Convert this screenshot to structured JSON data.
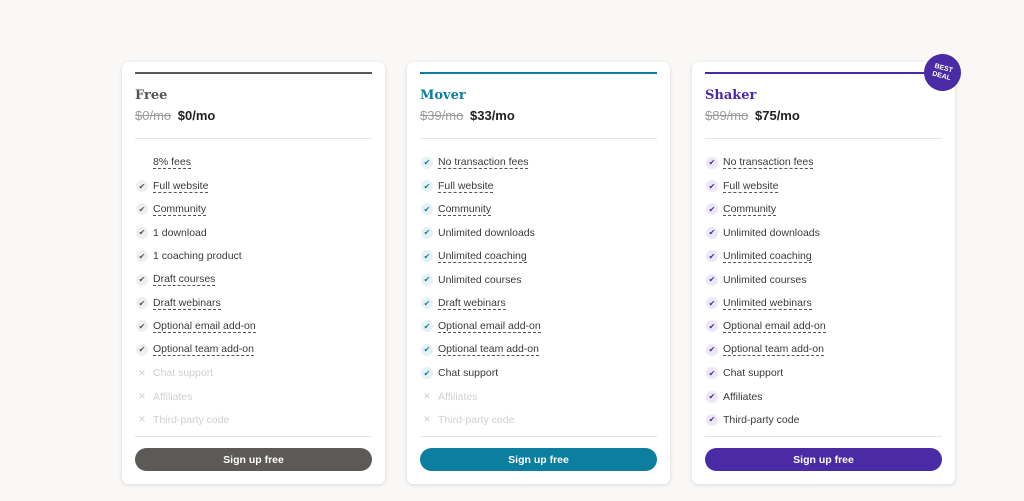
{
  "colors": {
    "free": "#5c5a57",
    "mover": "#0c7fa0",
    "shaker": "#4b2aa5",
    "background": "#f9f8f6"
  },
  "plans": [
    {
      "id": "free",
      "name": "Free",
      "old_price": "$0/mo",
      "new_price": "$0/mo",
      "cta": "Sign up free",
      "features": [
        {
          "label": "8% fees",
          "status": "none",
          "dashed": true
        },
        {
          "label": "Full website",
          "status": "yes",
          "dashed": true
        },
        {
          "label": "Community",
          "status": "yes",
          "dashed": true
        },
        {
          "label": "1 download",
          "status": "yes",
          "dashed": false
        },
        {
          "label": "1 coaching product",
          "status": "yes",
          "dashed": false
        },
        {
          "label": "Draft courses",
          "status": "yes",
          "dashed": true
        },
        {
          "label": "Draft webinars",
          "status": "yes",
          "dashed": true
        },
        {
          "label": "Optional email add-on",
          "status": "yes",
          "dashed": true
        },
        {
          "label": "Optional team add-on",
          "status": "yes",
          "dashed": true
        },
        {
          "label": "Chat support",
          "status": "no",
          "dashed": false
        },
        {
          "label": "Affiliates",
          "status": "no",
          "dashed": false
        },
        {
          "label": "Third-party code",
          "status": "no",
          "dashed": false
        }
      ]
    },
    {
      "id": "mover",
      "name": "Mover",
      "old_price": "$39/mo",
      "new_price": "$33/mo",
      "cta": "Sign up free",
      "features": [
        {
          "label": "No transaction fees",
          "status": "yes",
          "dashed": true
        },
        {
          "label": "Full website",
          "status": "yes",
          "dashed": true
        },
        {
          "label": "Community",
          "status": "yes",
          "dashed": true
        },
        {
          "label": "Unlimited downloads",
          "status": "yes",
          "dashed": false
        },
        {
          "label": "Unlimited coaching",
          "status": "yes",
          "dashed": true
        },
        {
          "label": "Unlimited courses",
          "status": "yes",
          "dashed": false
        },
        {
          "label": "Draft webinars",
          "status": "yes",
          "dashed": true
        },
        {
          "label": "Optional email add-on",
          "status": "yes",
          "dashed": true
        },
        {
          "label": "Optional team add-on",
          "status": "yes",
          "dashed": true
        },
        {
          "label": "Chat support",
          "status": "yes",
          "dashed": false
        },
        {
          "label": "Affiliates",
          "status": "no",
          "dashed": false
        },
        {
          "label": "Third-party code",
          "status": "no",
          "dashed": false
        }
      ]
    },
    {
      "id": "shaker",
      "name": "Shaker",
      "old_price": "$89/mo",
      "new_price": "$75/mo",
      "cta": "Sign up free",
      "badge": [
        "BEST",
        "DEAL"
      ],
      "features": [
        {
          "label": "No transaction fees",
          "status": "yes",
          "dashed": true
        },
        {
          "label": "Full website",
          "status": "yes",
          "dashed": true
        },
        {
          "label": "Community",
          "status": "yes",
          "dashed": true
        },
        {
          "label": "Unlimited downloads",
          "status": "yes",
          "dashed": false
        },
        {
          "label": "Unlimited coaching",
          "status": "yes",
          "dashed": true
        },
        {
          "label": "Unlimited courses",
          "status": "yes",
          "dashed": false
        },
        {
          "label": "Unlimited webinars",
          "status": "yes",
          "dashed": true
        },
        {
          "label": "Optional email add-on",
          "status": "yes",
          "dashed": true
        },
        {
          "label": "Optional team add-on",
          "status": "yes",
          "dashed": true
        },
        {
          "label": "Chat support",
          "status": "yes",
          "dashed": false
        },
        {
          "label": "Affiliates",
          "status": "yes",
          "dashed": false
        },
        {
          "label": "Third-party code",
          "status": "yes",
          "dashed": false
        }
      ]
    }
  ],
  "icons": {
    "yes": "check-icon",
    "no": "x-icon"
  }
}
